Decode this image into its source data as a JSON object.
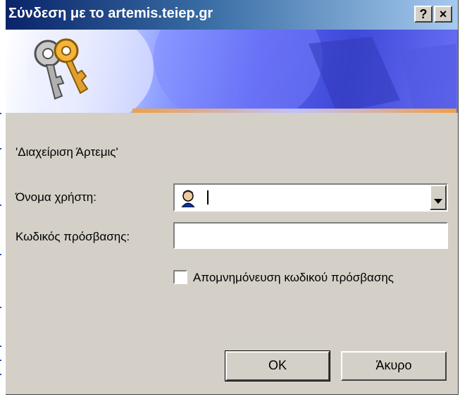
{
  "window": {
    "title": "Σύνδεση με το artemis.teiep.gr",
    "help_label": "?",
    "close_label": "×"
  },
  "icons": {
    "banner": "keys-icon",
    "user": "user-icon",
    "dropdown": "chevron-down-icon"
  },
  "dialog": {
    "realm": "'Διαχείριση Άρτεμις'",
    "username_label": "Όνομα χρήστη:",
    "username_value": "",
    "password_label": "Κωδικός πρόσβασης:",
    "password_value": "",
    "remember_label": "Απομνημόνευση κωδικού πρόσβασης",
    "remember_checked": false,
    "ok_label": "OK",
    "cancel_label": "Άκυρο"
  },
  "colors": {
    "titlebar_start": "#0a246a",
    "face": "#d4d0c8"
  }
}
